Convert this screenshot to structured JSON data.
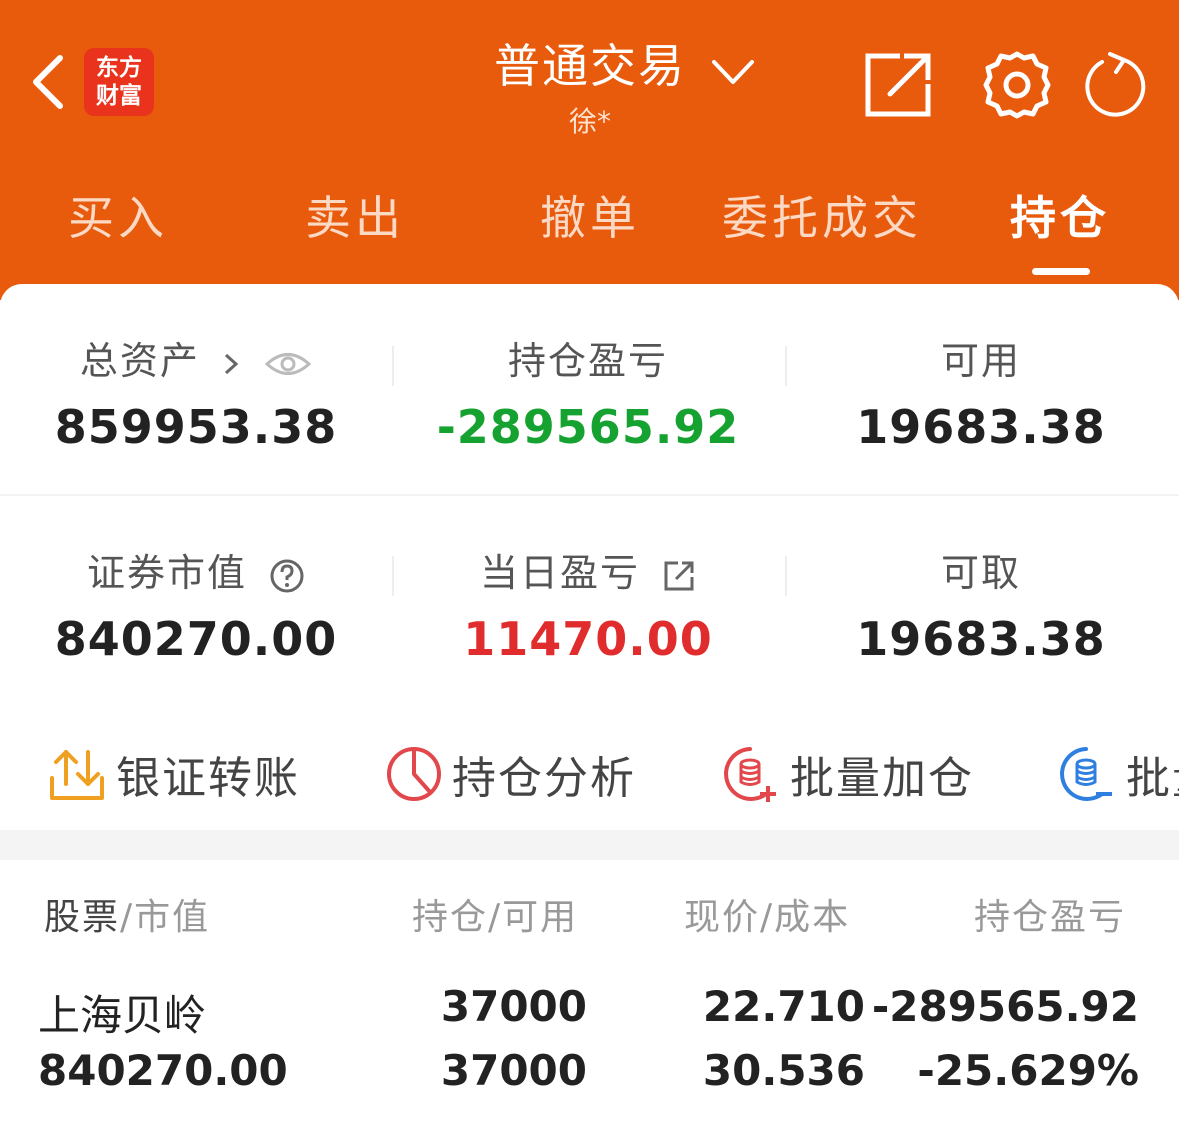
{
  "header": {
    "logo_line1": "东方",
    "logo_line2": "财富",
    "title": "普通交易",
    "subtitle": "徐*",
    "colors": {
      "bar": "#e85a0c",
      "logo": "#e9331d"
    }
  },
  "tabs": [
    {
      "label": "买入"
    },
    {
      "label": "卖出"
    },
    {
      "label": "撤单"
    },
    {
      "label": "委托成交"
    },
    {
      "label": "持仓",
      "active": true
    }
  ],
  "summary": {
    "total_assets": {
      "label": "总资产",
      "value": "859953.38"
    },
    "position_pnl": {
      "label": "持仓盈亏",
      "value": "-289565.92"
    },
    "available": {
      "label": "可用",
      "value": "19683.38"
    },
    "market_value": {
      "label": "证券市值",
      "value": "840270.00"
    },
    "daily_pnl": {
      "label": "当日盈亏",
      "value": "11470.00"
    },
    "withdrawable": {
      "label": "可取",
      "value": "19683.38"
    }
  },
  "actions": [
    {
      "label": "银证转账",
      "icon": "transfer-icon"
    },
    {
      "label": "持仓分析",
      "icon": "pie-chart-icon"
    },
    {
      "label": "批量加仓",
      "icon": "batch-add-icon"
    },
    {
      "label": "批量",
      "icon": "batch-reduce-icon"
    }
  ],
  "table": {
    "headers": {
      "stock": "股票",
      "stock_sub": "/市值",
      "position": "持仓/可用",
      "price": "现价/成本",
      "pnl": "持仓盈亏"
    },
    "rows": [
      {
        "name": "上海贝岭",
        "market_value": "840270.00",
        "position": "37000",
        "available": "37000",
        "price": "22.710",
        "cost": "30.536",
        "pnl": "-289565.92",
        "pnl_pct": "-25.629%"
      }
    ]
  }
}
